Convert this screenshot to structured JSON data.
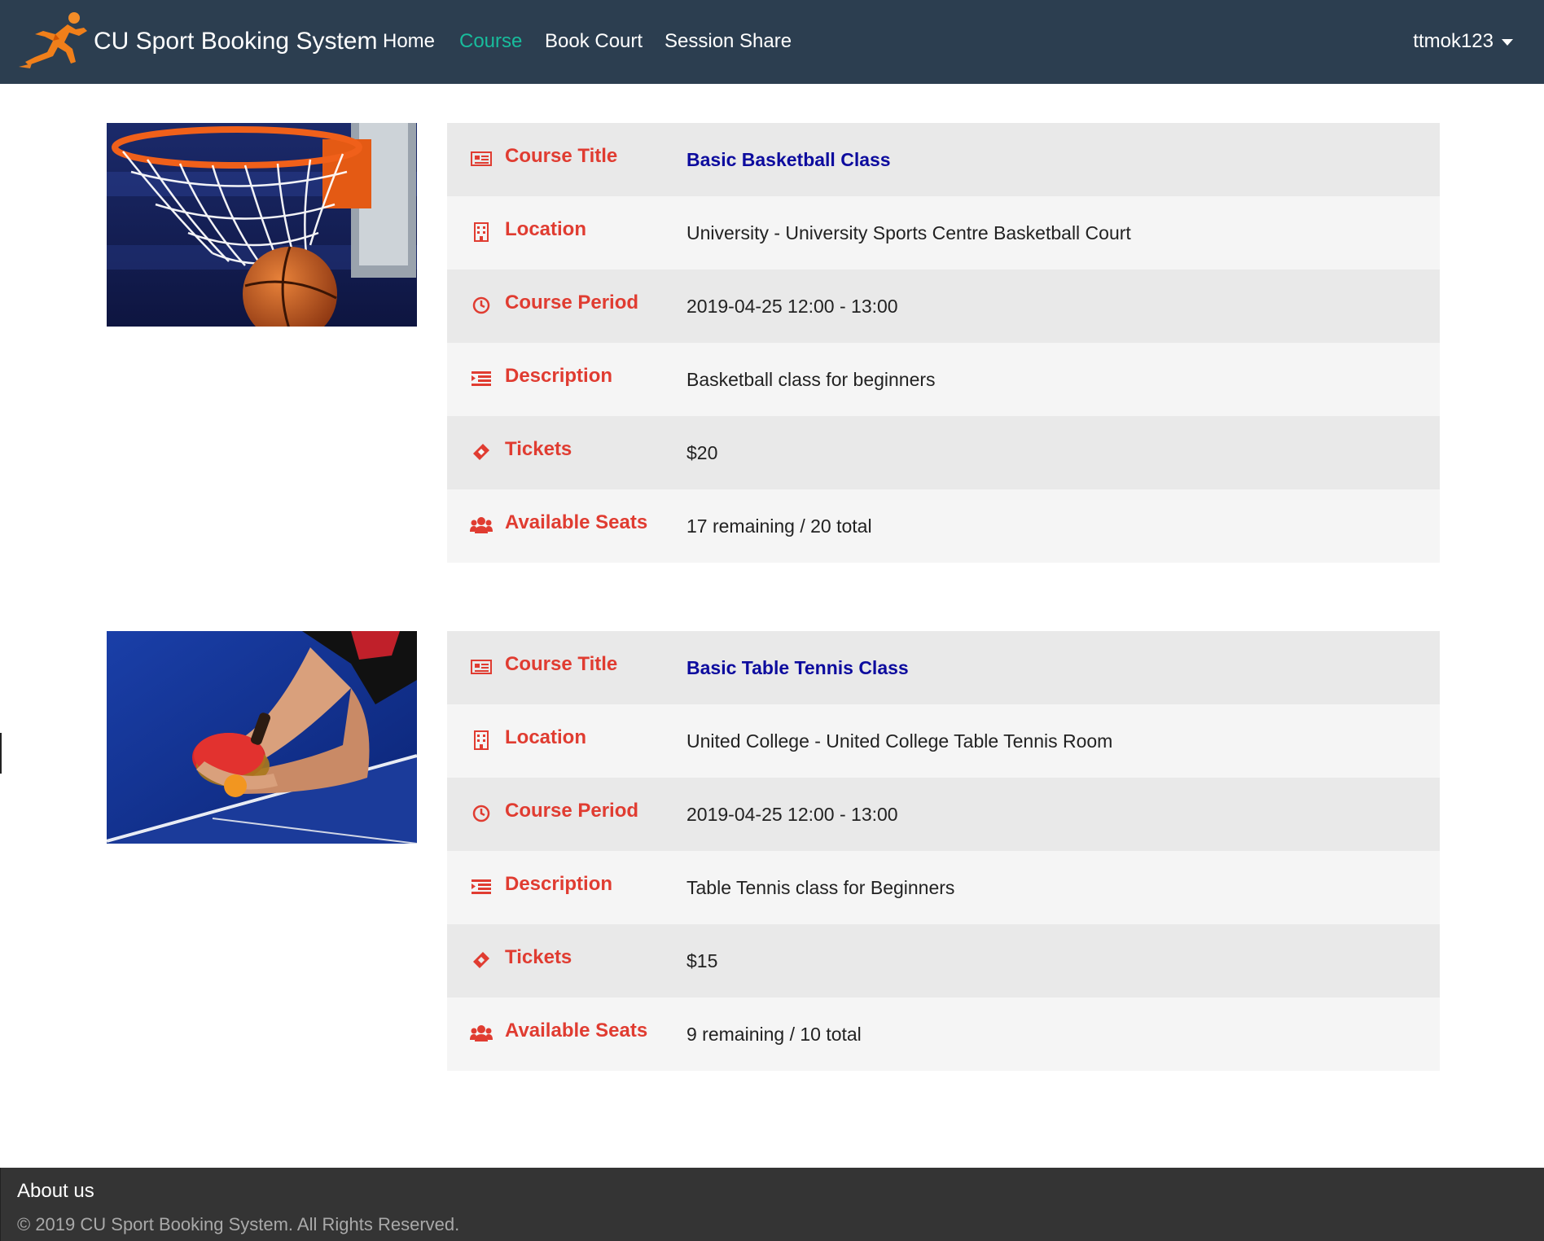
{
  "navbar": {
    "brand": "CU Sport Booking System",
    "links": [
      {
        "label": "Home",
        "active": false
      },
      {
        "label": "Course",
        "active": true
      },
      {
        "label": "Book Court",
        "active": false
      },
      {
        "label": "Session Share",
        "active": false
      }
    ],
    "user": "ttmok123"
  },
  "labels": {
    "title": "Course Title",
    "location": "Location",
    "period": "Course Period",
    "description": "Description",
    "tickets": "Tickets",
    "seats": "Available Seats"
  },
  "courses": [
    {
      "title": "Basic Basketball Class",
      "location": "University - University Sports Centre Basketball Court",
      "period": "2019-04-25 12:00 - 13:00",
      "description": "Basketball class for beginners",
      "tickets": "$20",
      "seats": "17 remaining / 20 total",
      "image_icon": "basketball-hoop-photo"
    },
    {
      "title": "Basic Table Tennis Class",
      "location": "United College - United College Table Tennis Room",
      "period": "2019-04-25 12:00 - 13:00",
      "description": "Table Tennis class for Beginners",
      "tickets": "$15",
      "seats": "9 remaining / 10 total",
      "image_icon": "table-tennis-photo"
    }
  ],
  "footer": {
    "heading": "About us",
    "copyright": "© 2019 CU Sport Booking System. All Rights Reserved."
  },
  "colors": {
    "navbar_bg": "#2c3e50",
    "active_link": "#18bc9c",
    "label_red": "#e03c31",
    "title_blue": "#0d0c9e",
    "footer_bg": "#343434"
  }
}
